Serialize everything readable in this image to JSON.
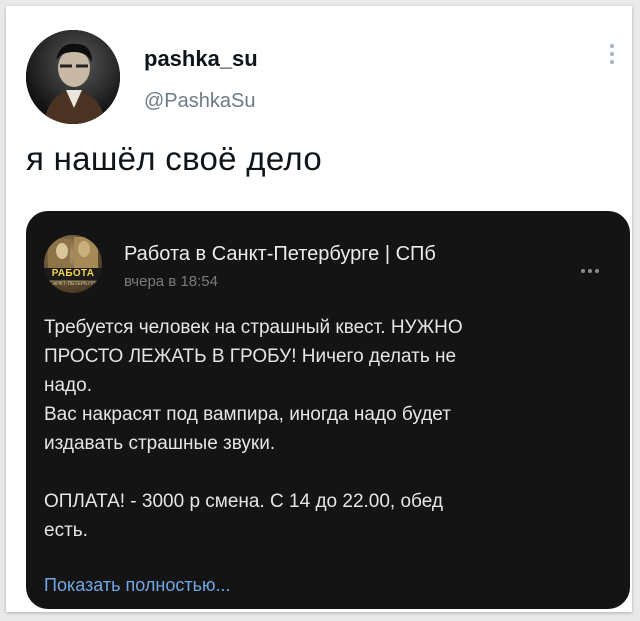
{
  "tweet": {
    "author_name": "pashka_su",
    "author_handle": "@PashkaSu",
    "text": "я нашёл своё дело"
  },
  "card": {
    "group_name": "Работа в Санкт-Петербурге | СПб",
    "group_avatar_label": "РАБОТА",
    "group_avatar_sublabel": "САНКТ-ПЕТЕРБУРГ",
    "time": "вчера в 18:54",
    "body_lines": [
      "Требуется человек на страшный квест. НУЖНО",
      "ПРОСТО ЛЕЖАТЬ В ГРОБУ! Ничего делать не",
      "надо.",
      "Вас накрасят под вампира, иногда надо будет",
      "издавать страшные звуки."
    ],
    "payment_lines": [
      "ОПЛАТА! - 3000 р смена. С 14 до 22.00, обед",
      "есть."
    ],
    "show_more": "Показать полностью..."
  },
  "colors": {
    "card_bg": "#141414",
    "link": "#71a7e5",
    "handle": "#6e7b86"
  }
}
